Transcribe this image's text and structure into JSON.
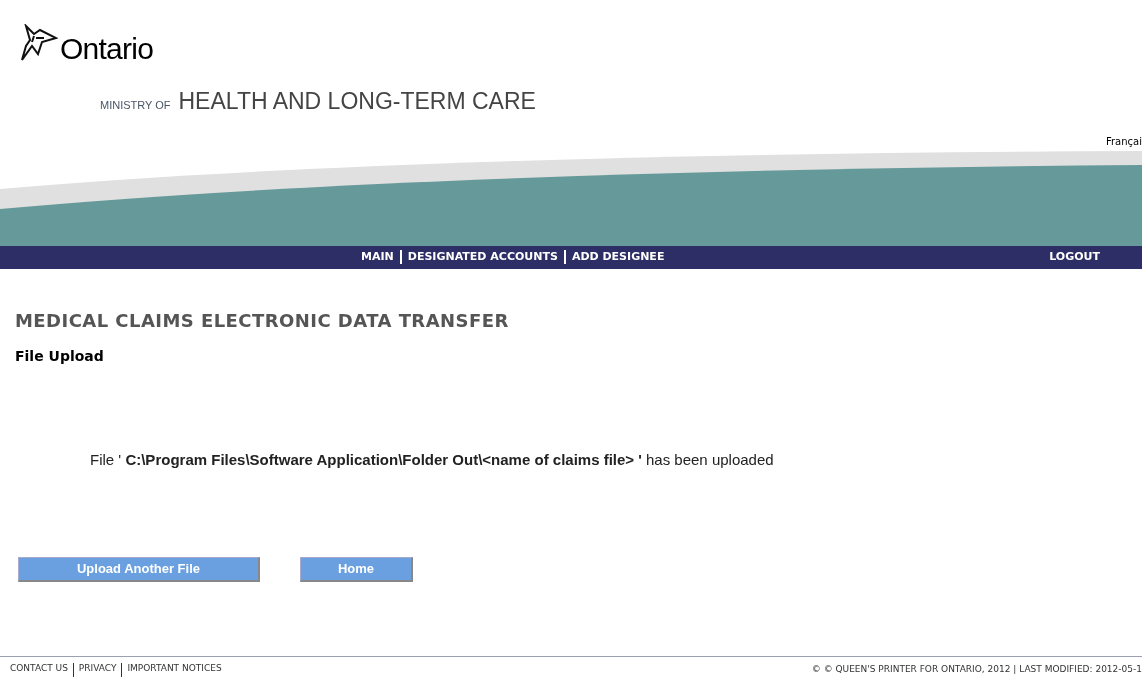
{
  "header": {
    "logo_text": "Ontario",
    "ministry_prefix": "MINISTRY OF",
    "ministry_name": "HEALTH AND LONG-TERM CARE",
    "language_link": "Françai"
  },
  "nav": {
    "items": [
      "MAIN",
      "DESIGNATED ACCOUNTS",
      "ADD DESIGNEE"
    ],
    "logout": "LOGOUT"
  },
  "title": "MEDICAL CLAIMS ELECTRONIC DATA TRANSFER",
  "subtitle": "File Upload",
  "message": "File ' **C:\\Program Files\\Software Application\\Folder Out\\<name of claims file>  '** has been uploaded",
  "buttons": [
    "Upload Another File",
    "Home"
  ],
  "footer": {
    "links": [
      "CONTACT US",
      "PRIVACY",
      "IMPORTANT NOTICES"
    ],
    "copyright": "© © QUEEN'S PRINTER FOR ONTARIO, 2012 | LAST MODIFIED:  2012-05-1"
  }
}
